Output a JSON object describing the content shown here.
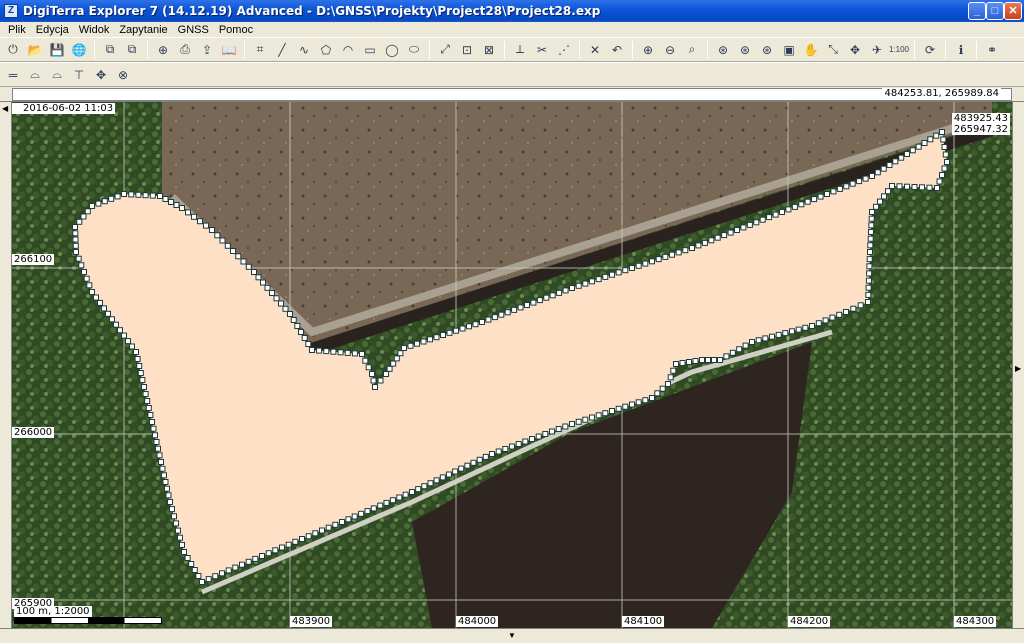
{
  "window": {
    "title": "DigiTerra Explorer 7 (14.12.19) Advanced - D:\\GNSS\\Projekty\\Project28\\Project28.exp",
    "app_icon": "Z",
    "controls": {
      "minimize": "_",
      "maximize": "□",
      "close": "✕"
    }
  },
  "menu": [
    "Plik",
    "Edycja",
    "Widok",
    "Zapytanie",
    "GNSS",
    "Pomoc"
  ],
  "toolbar1_icons": [
    "power-icon",
    "open-icon",
    "save-icon",
    "globe-icon",
    "|",
    "layers-icon",
    "layers-edit-icon",
    "|",
    "add-circle-icon",
    "print-icon",
    "export-icon",
    "book-icon",
    "|",
    "point-icon",
    "line-icon",
    "polyline-icon",
    "polygon-icon",
    "curve-polygon-icon",
    "rectangle-icon",
    "circle-icon",
    "ellipse-icon",
    "|",
    "zoom-window-icon",
    "zoom-layer-icon",
    "zoom-extent-icon",
    "|",
    "split-icon",
    "cut-icon",
    "join-icon",
    "|",
    "delete-icon",
    "undo-icon",
    "|",
    "zoom-in-icon",
    "zoom-out-icon",
    "zoom-select-icon",
    "|",
    "gps-icon",
    "gps-edit-icon",
    "gps-zoom-icon",
    "gps-record-icon",
    "pan-hand-icon",
    "fullscreen-icon",
    "target-icon",
    "plane-icon",
    "scale-icon",
    "|",
    "refresh-icon",
    "|",
    "info-icon",
    "|",
    "binoculars-icon"
  ],
  "toolbar2_icons": [
    "ruler-icon",
    "measure-area-icon",
    "measure-edit-icon",
    "gps-antenna-icon",
    "navigate-icon",
    "gps-off-icon"
  ],
  "glyphs": {
    "power-icon": "⏻",
    "open-icon": "📂",
    "save-icon": "💾",
    "globe-icon": "🌐",
    "layers-icon": "⧉",
    "layers-edit-icon": "⧉",
    "add-circle-icon": "⊕",
    "print-icon": "⎙",
    "export-icon": "⇪",
    "book-icon": "📖",
    "point-icon": "⌗",
    "line-icon": "╱",
    "polyline-icon": "∿",
    "polygon-icon": "⬠",
    "curve-polygon-icon": "◠",
    "rectangle-icon": "▭",
    "circle-icon": "◯",
    "ellipse-icon": "⬭",
    "zoom-window-icon": "⤢",
    "zoom-layer-icon": "⊡",
    "zoom-extent-icon": "⊠",
    "split-icon": "⟂",
    "cut-icon": "✂",
    "join-icon": "⋰",
    "delete-icon": "✕",
    "undo-icon": "↶",
    "zoom-in-icon": "⊕",
    "zoom-out-icon": "⊖",
    "zoom-select-icon": "⌕",
    "gps-icon": "⊛",
    "gps-edit-icon": "⊛",
    "gps-zoom-icon": "⊛",
    "gps-record-icon": "▣",
    "pan-hand-icon": "✋",
    "fullscreen-icon": "⤡",
    "target-icon": "✥",
    "plane-icon": "✈",
    "scale-icon": "1:100",
    "refresh-icon": "⟳",
    "info-icon": "ℹ",
    "binoculars-icon": "⚭",
    "ruler-icon": "═",
    "measure-area-icon": "⌓",
    "measure-edit-icon": "⌓",
    "gps-antenna-icon": "⊤",
    "navigate-icon": "✥",
    "gps-off-icon": "⊗"
  },
  "status": {
    "cursor_coords": "484253.81, 265989.84"
  },
  "map": {
    "date": "2016-06-02 11:03",
    "corner_x": "483925.43",
    "corner_y": "265947.32",
    "y_labels": [
      "266100",
      "266000",
      "265900"
    ],
    "x_labels": [
      "483900",
      "484000",
      "484100",
      "484200",
      "484300"
    ],
    "scale_text": "100 m, 1:2000",
    "colors": {
      "polygon_fill": "#fde0c6",
      "vertex": "#1f3a3a",
      "forest": "#2f4a24",
      "field": "#7d6a55",
      "water": "#2e2420"
    }
  }
}
